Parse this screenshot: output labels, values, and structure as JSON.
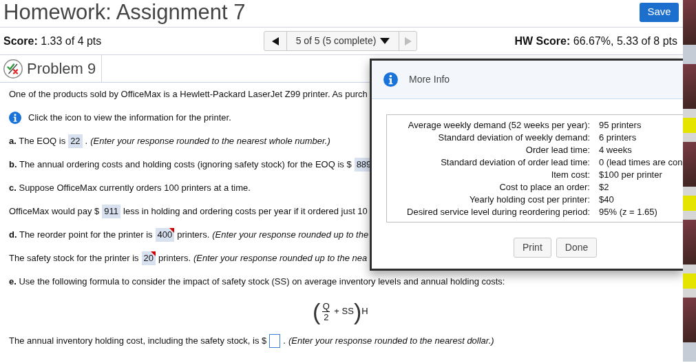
{
  "header": {
    "title": "Homework: Assignment 7",
    "save_button": "Save"
  },
  "score_bar": {
    "score_label": "Score:",
    "score_value": "1.33 of 4 pts",
    "navigator": {
      "previous_disabled": false,
      "position": "5 of 5 (5 complete)",
      "next_disabled": true
    },
    "hw_score_label": "HW Score:",
    "hw_score_value": "66.67%, 5.33 of 8 pts"
  },
  "problem": {
    "some_correct": true,
    "some_incorrect": true,
    "title": "Problem 9"
  },
  "question": {
    "lines": [
      {
        "kind": "sentence",
        "segments": [
          {
            "kind": "text",
            "text": "One of the products sold by OfficeMax is a Hewlett-Packard LaserJet Z99 printer. As purch"
          }
        ]
      },
      {
        "kind": "sentence",
        "segments": [
          {
            "kind": "info_icon"
          },
          {
            "kind": "text",
            "text": "Click the icon to view the information for the printer."
          }
        ]
      },
      {
        "kind": "sentence",
        "segments": [
          {
            "kind": "text",
            "text": "**a.** The EOQ is"
          },
          {
            "kind": "answer",
            "value": "22",
            "incorrect": false
          },
          {
            "kind": "text",
            "text": "."
          },
          {
            "kind": "hint",
            "text": "(Enter your response rounded to the nearest whole number.)"
          }
        ]
      },
      {
        "kind": "sentence",
        "segments": [
          {
            "kind": "text",
            "text": "**b.** The annual ordering costs and holding costs (ignoring safety stock) for the EOQ is $"
          },
          {
            "kind": "answer",
            "value": "889",
            "incorrect": false
          }
        ]
      },
      {
        "kind": "sentence",
        "segments": [
          {
            "kind": "text",
            "text": "**c.** Suppose OfficeMax currently orders 100 printers at a time."
          }
        ]
      },
      {
        "kind": "sentence",
        "segments": [
          {
            "kind": "text",
            "text": "OfficeMax would pay $"
          },
          {
            "kind": "answer",
            "value": "911",
            "incorrect": false
          },
          {
            "kind": "text",
            "text": "less in holding and ordering costs per year if it ordered just 10"
          }
        ]
      },
      {
        "kind": "sentence",
        "segments": [
          {
            "kind": "text",
            "text": "**d.** The reorder point for the printer is"
          },
          {
            "kind": "answer",
            "value": "400",
            "incorrect": true
          },
          {
            "kind": "text",
            "text": "printers."
          },
          {
            "kind": "hint",
            "text": "(Enter your response rounded up to the"
          }
        ]
      },
      {
        "kind": "sentence",
        "segments": [
          {
            "kind": "text",
            "text": "The safety stock for the printer is"
          },
          {
            "kind": "answer",
            "value": "20",
            "incorrect": true
          },
          {
            "kind": "text",
            "text": "printers."
          },
          {
            "kind": "hint",
            "text": "(Enter your response rounded up to the nea"
          }
        ]
      },
      {
        "kind": "sentence",
        "segments": [
          {
            "kind": "text",
            "text": "**e.** Use the following formula to consider the impact of safety stock (SS) on average inventory levels and annual holding costs:"
          }
        ]
      },
      {
        "kind": "formula",
        "open": "(",
        "numerator": "Q",
        "denominator": "2",
        "term": "+ SS",
        "close": ")",
        "factor": "H"
      },
      {
        "kind": "sentence",
        "segments": [
          {
            "kind": "text",
            "text": "The annual inventory holding cost, including the safety stock, is $"
          },
          {
            "kind": "answer",
            "incorrect": false
          },
          {
            "kind": "text",
            "text": "."
          },
          {
            "kind": "hint",
            "text": "(Enter your response rounded to the nearest dollar.)"
          }
        ]
      }
    ]
  },
  "more_info": {
    "title": "More Info",
    "rows": [
      {
        "label": "Average weekly demand (52 weeks per year):",
        "value": "95 printers"
      },
      {
        "label": "Standard deviation of weekly demand:",
        "value": "6 printers"
      },
      {
        "label": "Order lead time:",
        "value": "4 weeks"
      },
      {
        "label": "Standard deviation of order lead time:",
        "value": "0 (lead times are con"
      },
      {
        "label": "Item cost:",
        "value": "$100 per printer"
      },
      {
        "label": "Cost to place an order:",
        "value": "$2"
      },
      {
        "label": "Yearly holding cost per printer:",
        "value": "$40"
      },
      {
        "label": "Desired service level during reordering period:",
        "value": "95% (z = 1.65)"
      }
    ],
    "buttons": [
      "Print",
      "Done"
    ]
  },
  "side_strip": [
    {
      "kind": "photo"
    },
    {
      "kind": "screenshot"
    },
    {
      "kind": "photo"
    },
    {
      "kind": "document"
    },
    {
      "kind": "photo"
    },
    {
      "kind": "document"
    },
    {
      "kind": "photo"
    },
    {
      "kind": "document"
    },
    {
      "kind": "photo"
    },
    {
      "kind": "screenshot"
    }
  ]
}
